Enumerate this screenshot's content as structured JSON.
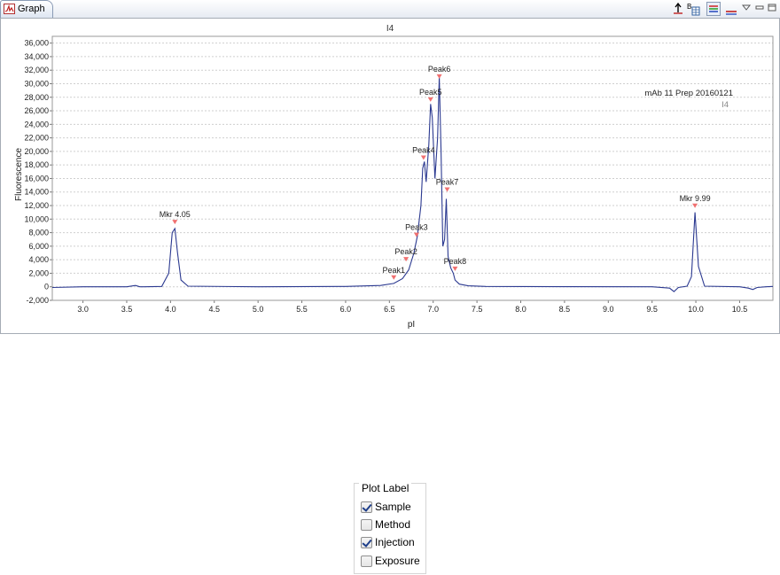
{
  "window": {
    "tab_label": "Graph",
    "tab_icon": "graph-icon"
  },
  "toolbar": {
    "icons": [
      "peak-marker-icon",
      "peak-table-icon",
      "legend-icon",
      "line-style-icon",
      "view-menu-icon",
      "minimize-icon",
      "maximize-icon"
    ]
  },
  "colors": {
    "trace": "#2b3990",
    "marker": "#f07070",
    "grid": "#cfcfcf"
  },
  "chart_data": {
    "type": "line",
    "title": "I4",
    "xlabel": "pI",
    "ylabel": "Fluorescence",
    "xlim": [
      2.65,
      10.88
    ],
    "ylim": [
      -2000,
      37000
    ],
    "xticks": [
      "3.0",
      "3.5",
      "4.0",
      "4.5",
      "5.0",
      "5.5",
      "6.0",
      "6.5",
      "7.0",
      "7.5",
      "8.0",
      "8.5",
      "9.0",
      "9.5",
      "10.0",
      "10.5"
    ],
    "yticks": [
      "-2,000",
      "0",
      "2,000",
      "4,000",
      "6,000",
      "8,000",
      "10,000",
      "12,000",
      "14,000",
      "16,000",
      "18,000",
      "20,000",
      "22,000",
      "24,000",
      "26,000",
      "28,000",
      "30,000",
      "32,000",
      "34,000",
      "36,000"
    ],
    "grid": true,
    "annotation": {
      "line1": "mAb 11 Prep 20160121",
      "line2": "I4"
    },
    "series": [
      {
        "x": [
          2.65,
          3.0,
          3.5,
          3.6,
          3.65,
          3.7,
          3.9,
          3.98,
          4.02,
          4.05,
          4.08,
          4.12,
          4.2,
          5.0,
          6.0,
          6.4,
          6.55,
          6.65,
          6.72,
          6.78,
          6.82,
          6.86,
          6.88,
          6.9,
          6.92,
          6.95,
          6.97,
          6.99,
          7.02,
          7.05,
          7.07,
          7.09,
          7.11,
          7.13,
          7.15,
          7.17,
          7.2,
          7.23,
          7.25,
          7.3,
          7.4,
          7.6,
          8.5,
          9.5,
          9.7,
          9.75,
          9.8,
          9.9,
          9.95,
          9.99,
          10.03,
          10.1,
          10.5,
          10.6,
          10.65,
          10.7,
          10.8,
          10.88
        ],
        "y": [
          -100,
          0,
          0,
          200,
          0,
          0,
          50,
          2000,
          8000,
          8600,
          5000,
          1000,
          100,
          0,
          50,
          200,
          500,
          1200,
          2500,
          5000,
          7500,
          12000,
          17500,
          18500,
          15500,
          21000,
          27000,
          25000,
          16000,
          22000,
          31000,
          20000,
          6000,
          7000,
          13000,
          4500,
          2800,
          2000,
          1000,
          400,
          150,
          50,
          20,
          0,
          -200,
          -700,
          -100,
          100,
          1500,
          11000,
          3000,
          100,
          0,
          -200,
          -400,
          -100,
          0,
          50
        ]
      }
    ],
    "peaks": [
      {
        "label": "Mkr 4.05",
        "x": 4.05,
        "y": 9500
      },
      {
        "label": "Peak1",
        "x": 6.55,
        "y": 1300
      },
      {
        "label": "Peak2",
        "x": 6.69,
        "y": 4000
      },
      {
        "label": "Peak3",
        "x": 6.81,
        "y": 7600
      },
      {
        "label": "Peak4",
        "x": 6.89,
        "y": 19000
      },
      {
        "label": "Peak5",
        "x": 6.97,
        "y": 27600
      },
      {
        "label": "Peak6",
        "x": 7.07,
        "y": 31000
      },
      {
        "label": "Peak7",
        "x": 7.16,
        "y": 14300
      },
      {
        "label": "Peak8",
        "x": 7.25,
        "y": 2600
      },
      {
        "label": "Mkr 9.99",
        "x": 9.99,
        "y": 11900
      }
    ]
  },
  "plot_label": {
    "title": "Plot Label",
    "options": [
      {
        "label": "Sample",
        "checked": true
      },
      {
        "label": "Method",
        "checked": false
      },
      {
        "label": "Injection",
        "checked": true
      },
      {
        "label": "Exposure",
        "checked": false
      }
    ]
  }
}
